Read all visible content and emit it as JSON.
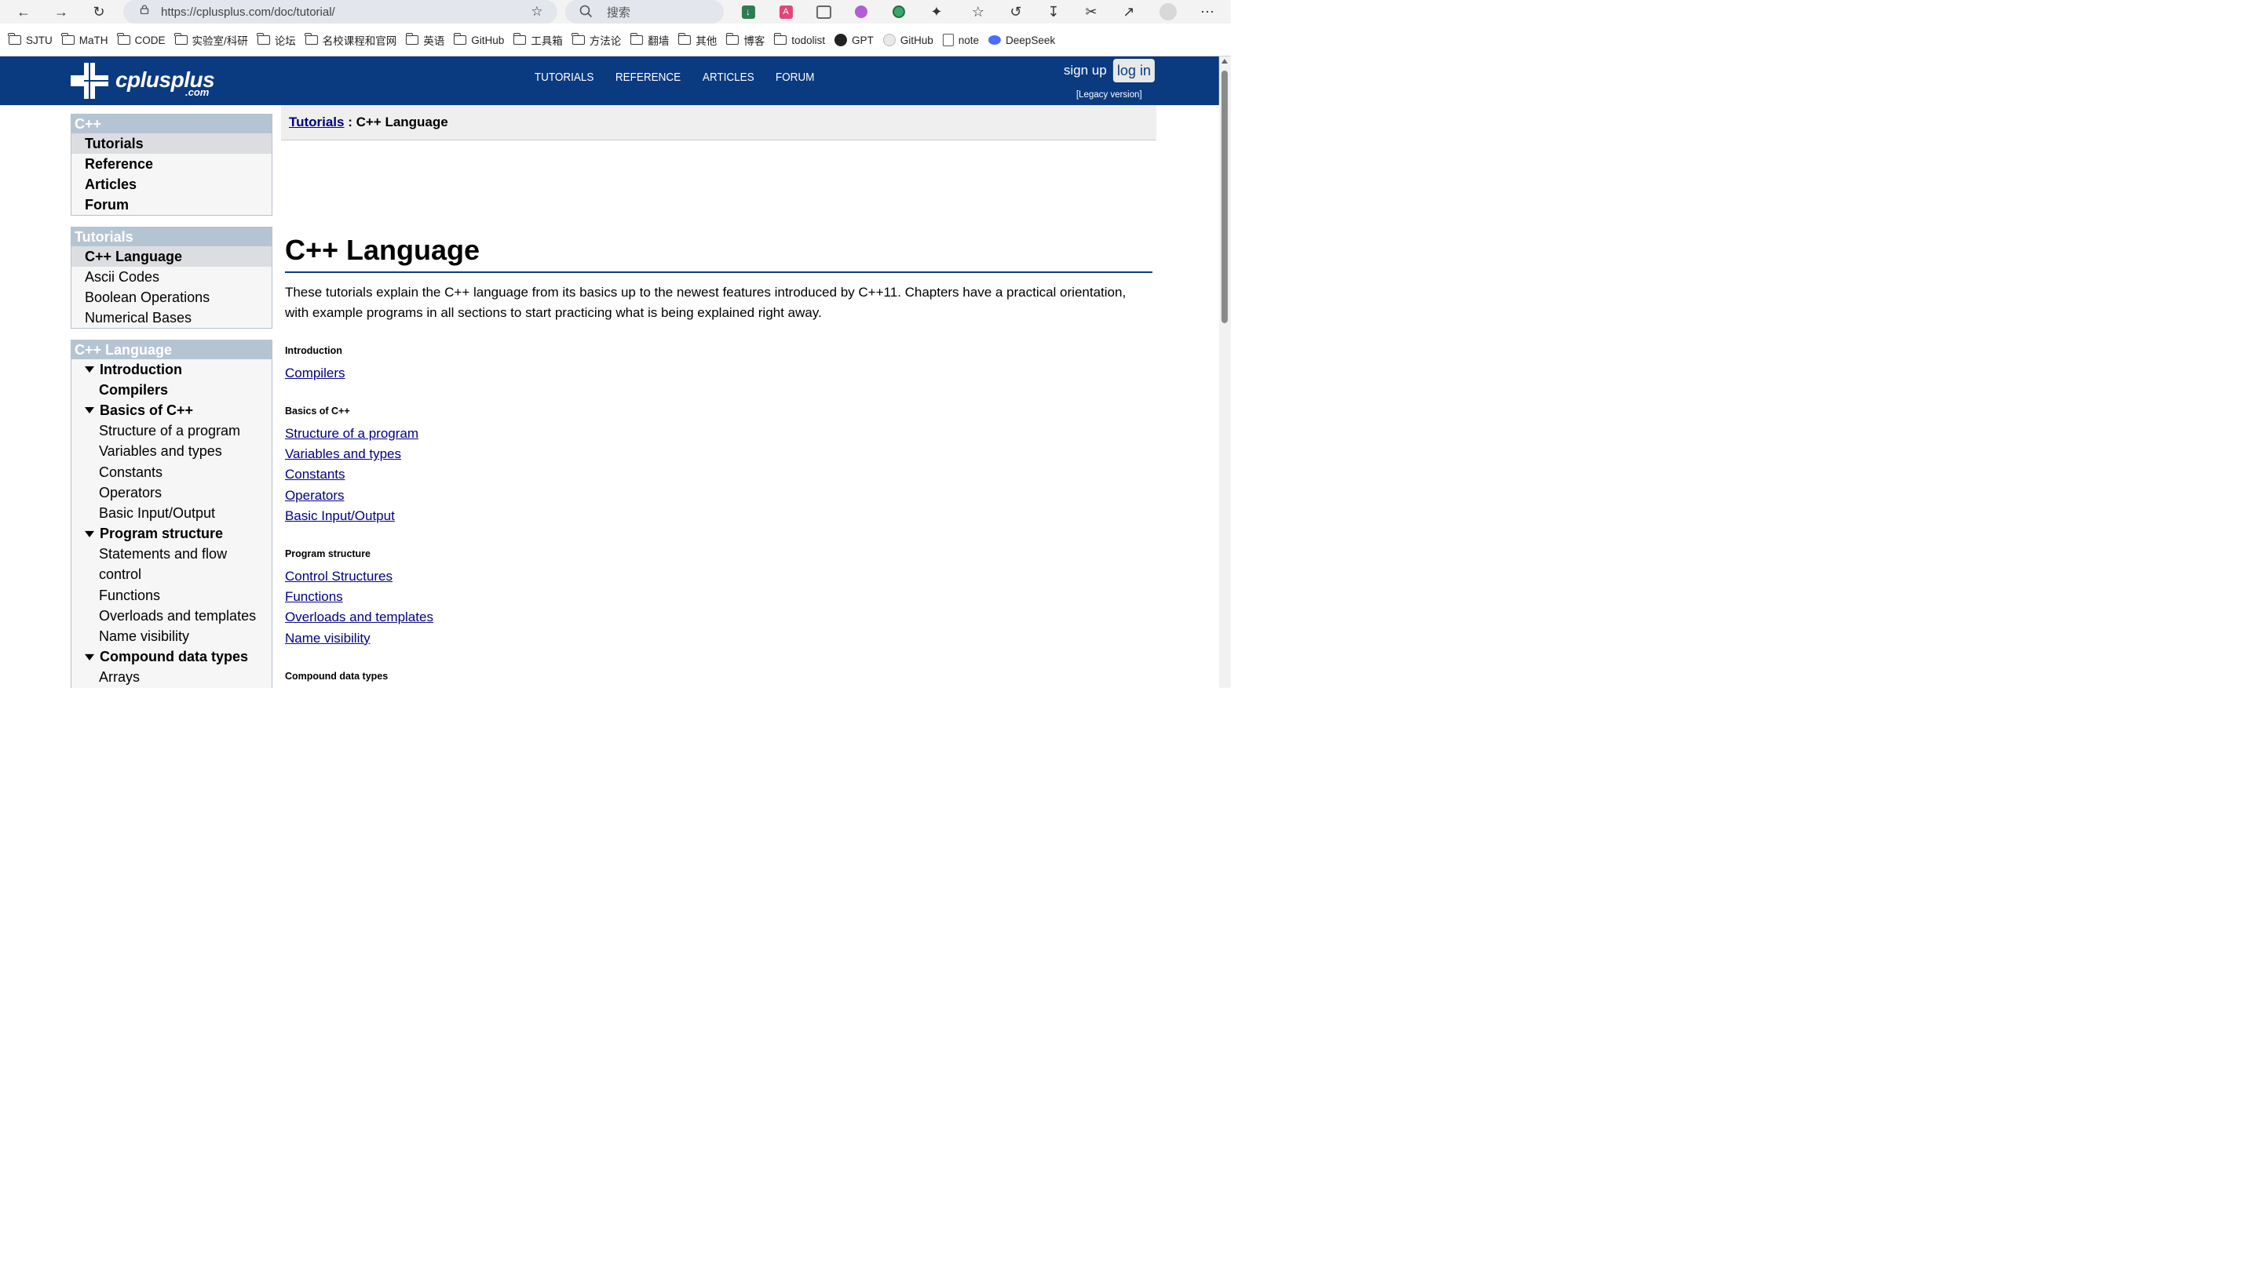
{
  "browser": {
    "url": "https://cplusplus.com/doc/tutorial/",
    "search_placeholder": "搜索",
    "bookmarks": [
      "SJTU",
      "MaTH",
      "CODE",
      "实验室/科研",
      "论坛",
      "名校课程和官网",
      "英语",
      "GitHub",
      "工具箱",
      "方法论",
      "翻墙",
      "其他",
      "博客",
      "todolist",
      "GPT",
      "GitHub",
      "note",
      "DeepSeek"
    ]
  },
  "site": {
    "logo_name": "cplusplus",
    "logo_suffix": ".com",
    "nav": [
      "TUTORIALS",
      "REFERENCE",
      "ARTICLES",
      "FORUM"
    ],
    "signup": "sign up",
    "login": "log in",
    "legacy": "[Legacy version]"
  },
  "sidebar": {
    "box1": {
      "title": "C++",
      "items": [
        "Tutorials",
        "Reference",
        "Articles",
        "Forum"
      ]
    },
    "box2": {
      "title": "Tutorials",
      "items": [
        "C++ Language",
        "Ascii Codes",
        "Boolean Operations",
        "Numerical Bases"
      ]
    },
    "box3": {
      "title": "C++ Language",
      "rows": [
        "Introduction",
        "Compilers",
        "Basics of C++",
        "Structure of a program",
        "Variables and types",
        "Constants",
        "Operators",
        "Basic Input/Output",
        "Program structure",
        "Statements and flow",
        "control",
        "Functions",
        "Overloads and templates",
        "Name visibility",
        "Compound data types",
        "Arrays"
      ]
    }
  },
  "main": {
    "breadcrumb_link": "Tutorials",
    "breadcrumb_rest": " : C++ Language",
    "title": "C++ Language",
    "intro": "These tutorials explain the C++ language from its basics up to the newest features introduced by C++11. Chapters have a practical orientation, with example programs in all sections to start practicing what is being explained right away.",
    "sections": [
      {
        "name": "Introduction",
        "links": [
          "Compilers"
        ]
      },
      {
        "name": "Basics of C++",
        "links": [
          "Structure of a program",
          "Variables and types",
          "Constants",
          "Operators",
          "Basic Input/Output"
        ]
      },
      {
        "name": "Program structure",
        "links": [
          "Control Structures",
          "Functions",
          "Overloads and templates",
          "Name visibility"
        ]
      },
      {
        "name": "Compound data types",
        "links": []
      }
    ]
  }
}
